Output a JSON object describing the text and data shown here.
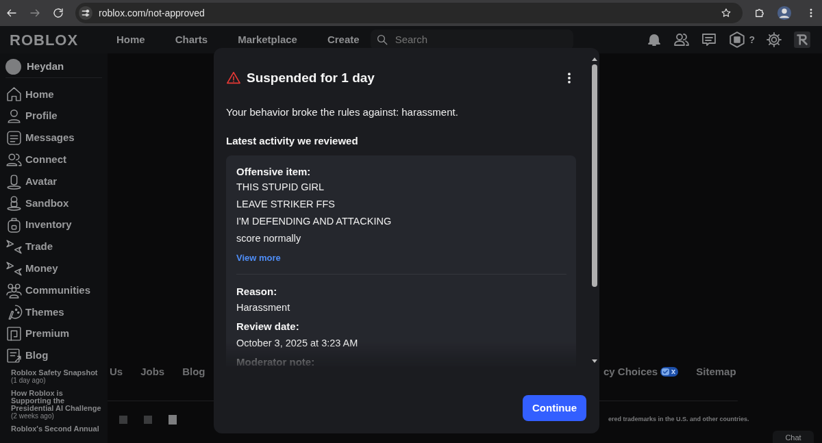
{
  "browser": {
    "url": "roblox.com/not-approved"
  },
  "navbar": {
    "logo": "ROBLOX",
    "links": [
      "Home",
      "Charts",
      "Marketplace",
      "Create"
    ],
    "search": {
      "placeholder": "Search"
    },
    "robux": "?"
  },
  "sidebar": {
    "user": "Heydan",
    "items": [
      "Home",
      "Profile",
      "Messages",
      "Connect",
      "Avatar",
      "Sandbox",
      "Inventory",
      "Trade",
      "Money",
      "Communities",
      "Themes",
      "Premium",
      "Blog"
    ],
    "blog_posts": [
      {
        "title": "Roblox Safety Snapshot",
        "age": "(1 day ago)"
      },
      {
        "title": "How Roblox is Supporting the Presidential AI Challenge",
        "age": "(2 weeks ago)"
      },
      {
        "title": "Roblox's Second Annual"
      }
    ]
  },
  "footer": {
    "links_left": [
      "Us",
      "Jobs",
      "Blog"
    ],
    "links_right": [
      "cy Choices",
      "Sitemap"
    ],
    "copyright": "ered trademarks in the U.S. and other countries.",
    "chat": "Chat"
  },
  "modal": {
    "title": "Suspended for 1 day",
    "message": "Your behavior broke the rules against: harassment.",
    "section_title": "Latest activity we reviewed",
    "offensive_label": "Offensive item:",
    "offensive_lines": [
      "THIS STUPID GIRL",
      "LEAVE STRIKER FFS",
      "I'M DEFENDING AND ATTACKING",
      "score normally"
    ],
    "view_more": "View more",
    "fields": [
      {
        "label": "Reason:",
        "value": "Harassment"
      },
      {
        "label": "Review date:",
        "value": "October 3, 2025 at 3:23 AM"
      }
    ],
    "moderator_note_label": "Moderator note:",
    "button": "Continue"
  }
}
